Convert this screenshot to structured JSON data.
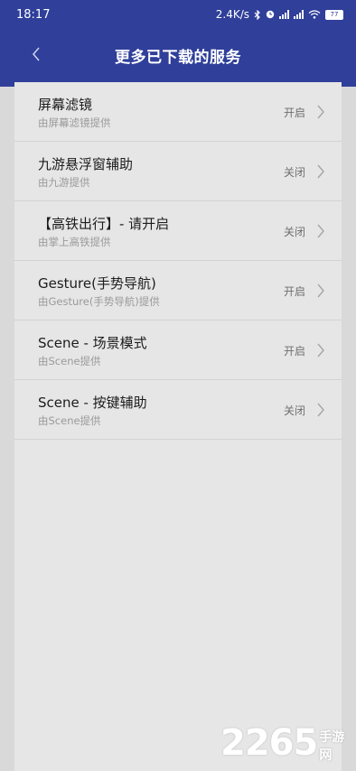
{
  "status": {
    "time": "18:17",
    "speed": "2.4K/s",
    "battery": "77"
  },
  "header": {
    "title": "更多已下载的服务"
  },
  "services": [
    {
      "name": "屏幕滤镜",
      "sub": "由屏幕滤镜提供",
      "state": "开启"
    },
    {
      "name": "九游悬浮窗辅助",
      "sub": "由九游提供",
      "state": "关闭"
    },
    {
      "name": "【高铁出行】- 请开启",
      "sub": "由掌上高铁提供",
      "state": "关闭"
    },
    {
      "name": "Gesture(手势导航)",
      "sub": "由Gesture(手势导航)提供",
      "state": "开启"
    },
    {
      "name": "Scene - 场景模式",
      "sub": "由Scene提供",
      "state": "开启"
    },
    {
      "name": "Scene - 按键辅助",
      "sub": "由Scene提供",
      "state": "关闭"
    }
  ],
  "watermark": {
    "number": "2265",
    "text": "手游网"
  },
  "icons": {
    "back": "chevron-left-icon",
    "row_arrow": "chevron-right-icon"
  },
  "colors": {
    "header": "#2f3f9a",
    "panel": "#e6e6e6",
    "background": "#d9d9d9"
  }
}
